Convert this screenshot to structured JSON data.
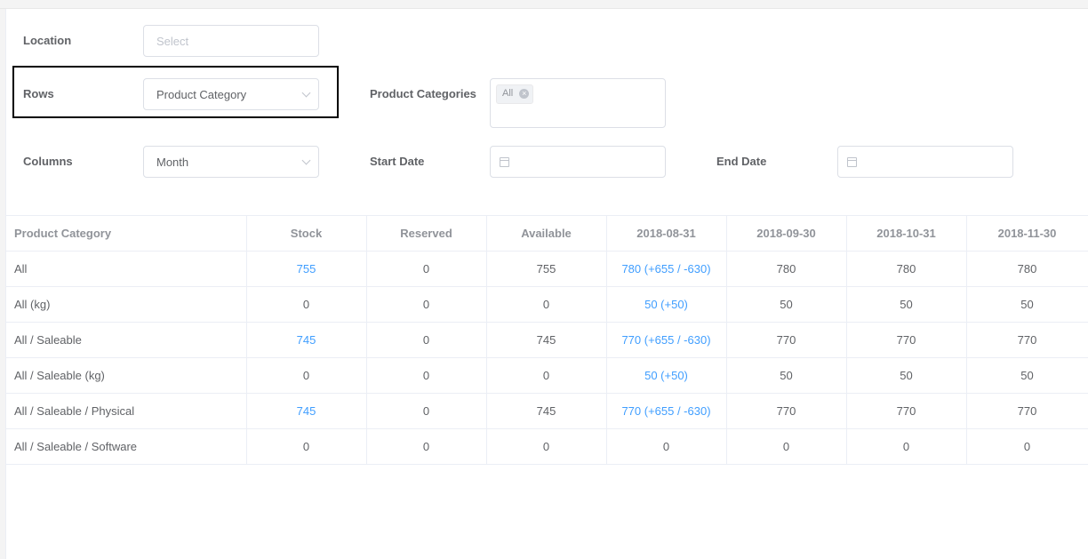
{
  "filters": {
    "location": {
      "label": "Location",
      "placeholder": "Select"
    },
    "rows": {
      "label": "Rows",
      "value": "Product Category"
    },
    "product_categories": {
      "label": "Product Categories",
      "tag": "All"
    },
    "columns": {
      "label": "Columns",
      "value": "Month"
    },
    "start_date": {
      "label": "Start Date"
    },
    "end_date": {
      "label": "End Date"
    }
  },
  "table": {
    "headers": [
      "Product Category",
      "Stock",
      "Reserved",
      "Available",
      "2018-08-31",
      "2018-09-30",
      "2018-10-31",
      "2018-11-30"
    ],
    "rows": [
      [
        "All",
        "755",
        "0",
        "755",
        "780 (+655 / -630)",
        "780",
        "780",
        "780"
      ],
      [
        "All (kg)",
        "0",
        "0",
        "0",
        "50 (+50)",
        "50",
        "50",
        "50"
      ],
      [
        "All / Saleable",
        "745",
        "0",
        "745",
        "770 (+655 / -630)",
        "770",
        "770",
        "770"
      ],
      [
        "All / Saleable (kg)",
        "0",
        "0",
        "0",
        "50 (+50)",
        "50",
        "50",
        "50"
      ],
      [
        "All / Saleable / Physical",
        "745",
        "0",
        "745",
        "770 (+655 / -630)",
        "770",
        "770",
        "770"
      ],
      [
        "All / Saleable / Software",
        "0",
        "0",
        "0",
        "0",
        "0",
        "0",
        "0"
      ]
    ],
    "link_color": "#409eff"
  }
}
